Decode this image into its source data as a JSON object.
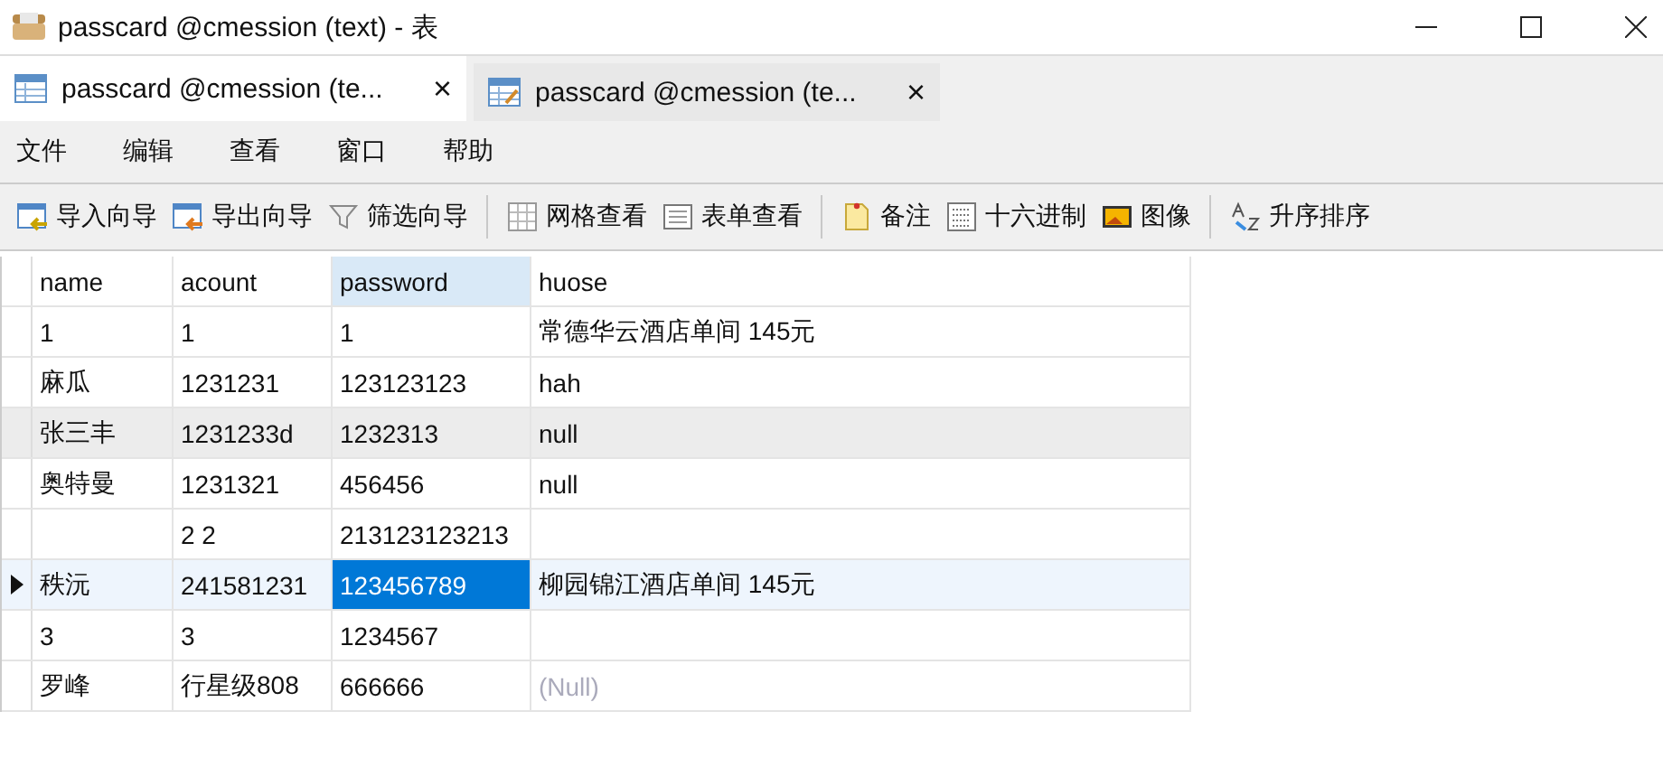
{
  "window": {
    "title": "passcard @cmession (text) - 表"
  },
  "tabs": [
    {
      "label": "passcard @cmession (te...",
      "close": "×",
      "selected": true
    },
    {
      "label": "passcard @cmession (te...",
      "close": "×",
      "selected": false
    }
  ],
  "menu": [
    "文件",
    "编辑",
    "查看",
    "窗口",
    "帮助"
  ],
  "toolbar": [
    [
      {
        "label": "导入向导",
        "disabled": false
      },
      {
        "label": "导出向导",
        "disabled": false
      },
      {
        "label": "筛选向导",
        "disabled": false
      }
    ],
    [
      {
        "label": "网格查看",
        "disabled": false
      },
      {
        "label": "表单查看",
        "disabled": false
      }
    ],
    [
      {
        "label": "备注",
        "disabled": false
      },
      {
        "label": "十六进制",
        "disabled": false
      },
      {
        "label": "图像",
        "disabled": false
      }
    ],
    [
      {
        "label": "升序排序",
        "disabled": false
      }
    ]
  ],
  "table": {
    "columns": [
      {
        "label": "name",
        "selected": false
      },
      {
        "label": "acount",
        "selected": false
      },
      {
        "label": "password",
        "selected": true
      },
      {
        "label": "huose",
        "selected": false
      }
    ],
    "rows": [
      {
        "selected": false,
        "shaded": false,
        "cells": [
          {
            "text": "1",
            "focused": false
          },
          {
            "text": "1",
            "focused": false
          },
          {
            "text": "1",
            "focused": false
          },
          {
            "text": "常德华云酒店单间 145元",
            "focused": false
          }
        ]
      },
      {
        "selected": false,
        "shaded": false,
        "cells": [
          {
            "text": "麻瓜",
            "focused": false
          },
          {
            "text": "1231231",
            "focused": false
          },
          {
            "text": "123123123",
            "focused": false
          },
          {
            "text": "hah",
            "focused": false
          }
        ]
      },
      {
        "selected": false,
        "shaded": true,
        "cells": [
          {
            "text": "张三丰",
            "focused": false
          },
          {
            "text": "1231233d",
            "focused": false
          },
          {
            "text": "1232313",
            "focused": false
          },
          {
            "text": "null",
            "focused": false
          }
        ]
      },
      {
        "selected": false,
        "shaded": false,
        "cells": [
          {
            "text": "奥特曼",
            "focused": false
          },
          {
            "text": "1231321",
            "focused": false
          },
          {
            "text": "456456",
            "focused": false
          },
          {
            "text": "null",
            "focused": false
          }
        ]
      },
      {
        "selected": false,
        "shaded": false,
        "cells": [
          {
            "text": "",
            "focused": false
          },
          {
            "text": "2 2",
            "focused": false
          },
          {
            "text": "213123123213",
            "focused": false
          },
          {
            "text": "",
            "focused": false
          }
        ]
      },
      {
        "selected": true,
        "shaded": false,
        "cells": [
          {
            "text": "秩沅",
            "focused": false
          },
          {
            "text": "241581231",
            "focused": false
          },
          {
            "text": "123456789",
            "focused": true
          },
          {
            "text": "柳园锦江酒店单间 145元",
            "focused": false
          }
        ]
      },
      {
        "selected": false,
        "shaded": false,
        "cells": [
          {
            "text": "3",
            "focused": false
          },
          {
            "text": "3",
            "focused": false
          },
          {
            "text": "1234567",
            "focused": false
          },
          {
            "text": "",
            "focused": false
          }
        ]
      },
      {
        "selected": false,
        "shaded": false,
        "cells": [
          {
            "text": "罗峰",
            "focused": false
          },
          {
            "text": "行星级808",
            "focused": false
          },
          {
            "text": "666666",
            "focused": false
          },
          {
            "text": "(Null)",
            "kind": "null",
            "focused": false
          }
        ]
      }
    ]
  }
}
